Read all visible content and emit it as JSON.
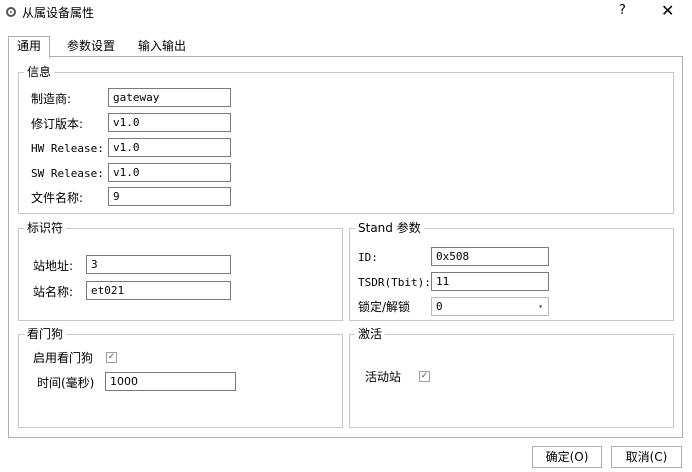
{
  "window": {
    "title": "从属设备属性",
    "help": "?",
    "close": "✕"
  },
  "tabs": [
    "通用",
    "参数设置",
    "输入输出"
  ],
  "info": {
    "title": "信息",
    "rows": [
      {
        "label": "制造商:",
        "value": "gateway"
      },
      {
        "label": "修订版本:",
        "value": "v1.0"
      },
      {
        "label": "HW Release:",
        "value": "v1.0"
      },
      {
        "label": "SW Release:",
        "value": "v1.0"
      },
      {
        "label": "文件名称:",
        "value": "9"
      }
    ]
  },
  "identifier": {
    "title": "标识符",
    "address_label": "站地址:",
    "address_value": "3",
    "name_label": "站名称:",
    "name_value": "et021"
  },
  "stand": {
    "title": "Stand 参数",
    "id_label": "ID:",
    "id_value": "0x508",
    "tsdr_label": "TSDR(Tbit):",
    "tsdr_value": "11",
    "lock_label": "锁定/解锁",
    "lock_value": "0"
  },
  "watchdog": {
    "title": "看门狗",
    "enable_label": "启用看门狗",
    "enable_checked": true,
    "time_label": "时间(毫秒)",
    "time_value": "1000"
  },
  "activate": {
    "title": "激活",
    "active_label": "活动站",
    "active_checked": true
  },
  "buttons": {
    "ok": "确定(O)",
    "cancel": "取消(C)"
  },
  "icons": {
    "checkmark": "✓",
    "dropdown": "▾"
  }
}
